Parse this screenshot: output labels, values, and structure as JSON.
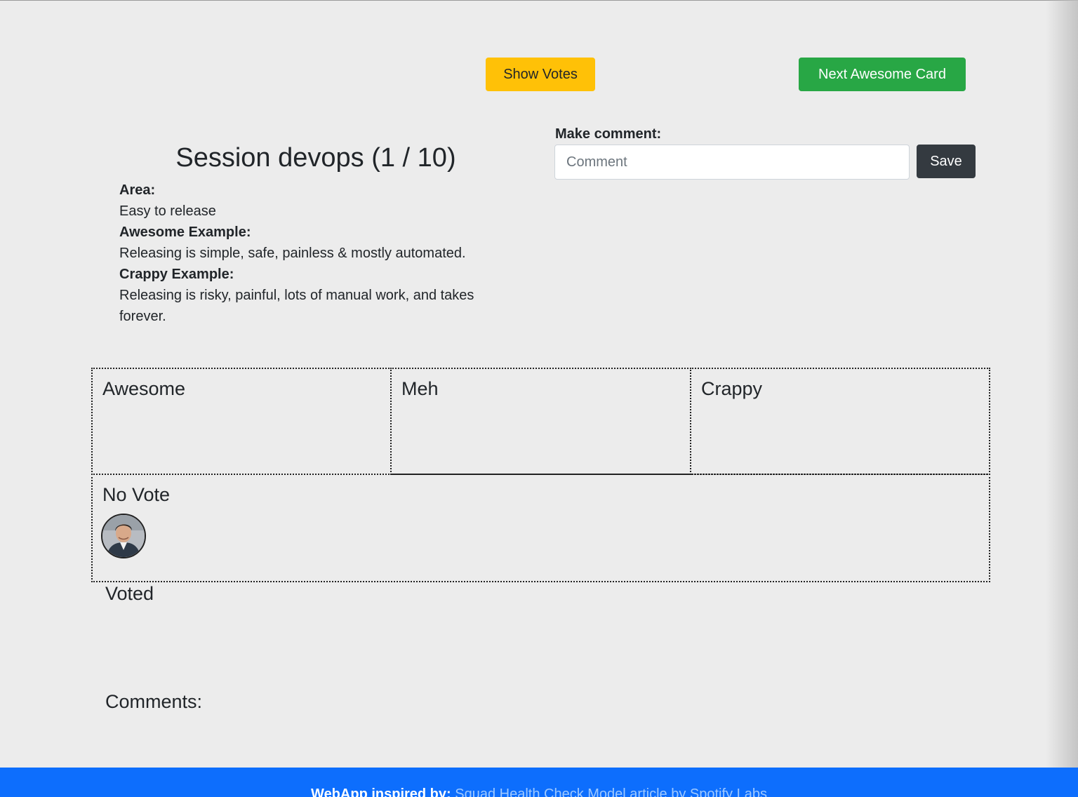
{
  "toolbar": {
    "show_votes_label": "Show Votes",
    "next_card_label": "Next Awesome Card"
  },
  "session": {
    "title": "Session devops (1 / 10)",
    "area_label": "Area:",
    "area_value": "Easy to release",
    "awesome_label": "Awesome Example:",
    "awesome_value": "Releasing is simple, safe, painless & mostly automated.",
    "crappy_label": "Crappy Example:",
    "crappy_value": "Releasing is risky, painful, lots of manual work, and takes forever."
  },
  "comment": {
    "label": "Make comment:",
    "placeholder": "Comment",
    "value": "",
    "save_label": "Save"
  },
  "votes": {
    "awesome": "Awesome",
    "meh": "Meh",
    "crappy": "Crappy",
    "no_vote": "No Vote"
  },
  "voted_heading": "Voted",
  "comments_heading": "Comments:",
  "footer": {
    "prefix": "WebApp inspired by: ",
    "link_text": "Squad Health Check Model article by Spotify Labs"
  },
  "colors": {
    "warning": "#ffc107",
    "success": "#28a745",
    "dark": "#343a40",
    "footer": "#0d6efd"
  }
}
